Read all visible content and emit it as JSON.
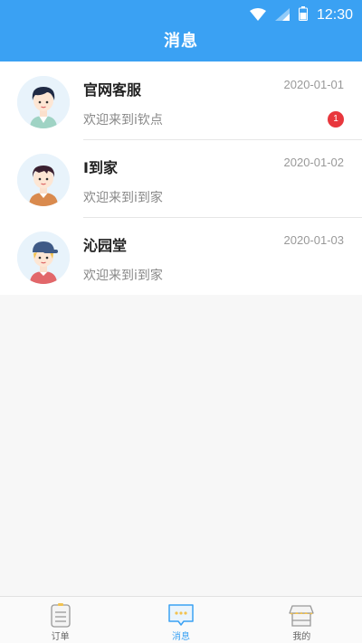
{
  "status_bar": {
    "time": "12:30"
  },
  "header": {
    "title": "消息"
  },
  "messages": [
    {
      "name": "官网客服",
      "date": "2020-01-01",
      "preview": "欢迎来到i钦点",
      "unread": "1",
      "avatar_icon": "avatar-boy-icon"
    },
    {
      "name": "I到家",
      "date": "2020-01-02",
      "preview": "欢迎来到i到家",
      "avatar_icon": "avatar-boy-orange-icon"
    },
    {
      "name": "沁园堂",
      "date": "2020-01-03",
      "preview": "欢迎来到i到家",
      "avatar_icon": "avatar-boy-cap-icon"
    }
  ],
  "tabs": [
    {
      "label": "订单",
      "icon": "order-icon",
      "active": false
    },
    {
      "label": "消息",
      "icon": "message-icon",
      "active": true
    },
    {
      "label": "我的",
      "icon": "shop-icon",
      "active": false
    }
  ],
  "colors": {
    "accent": "#3aa1f3",
    "badge": "#e8373d"
  }
}
